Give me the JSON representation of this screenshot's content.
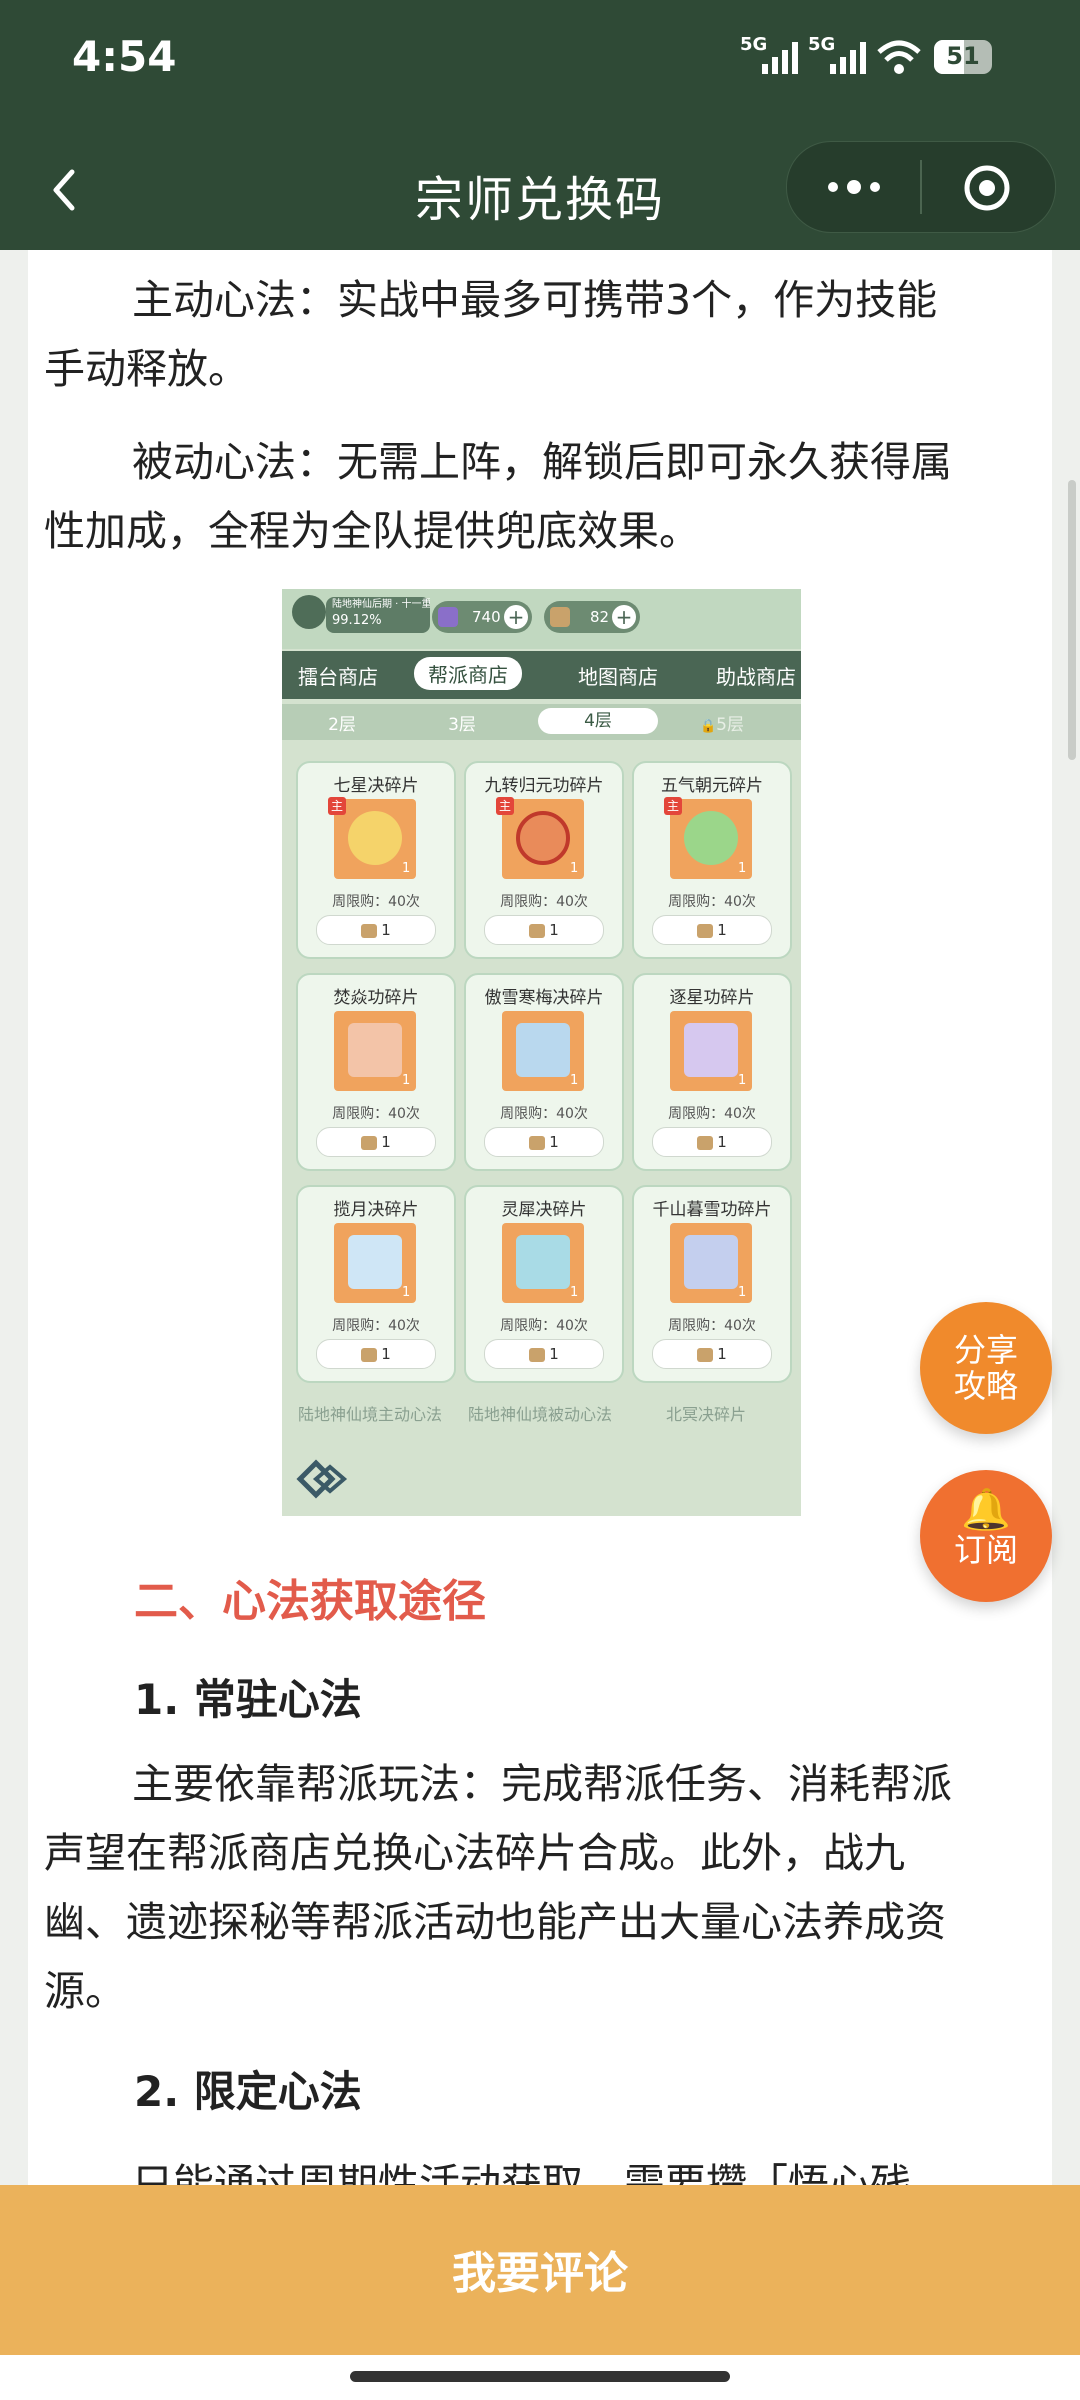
{
  "status_bar": {
    "time": "4:54",
    "net1": "5G",
    "net2": "5G",
    "battery": "51"
  },
  "nav": {
    "title": "宗师兑换码"
  },
  "article": {
    "p1_lines": [
      "主动心法：实战中最多可携带3个，作为技能",
      "手动释放。"
    ],
    "p2_lines": [
      "被动心法：无需上阵，解锁后即可永久获得属",
      "性加成，全程为全队提供兜底效果。"
    ],
    "section2_title": "二、心法获取途径",
    "sub1_title": "1. 常驻心法",
    "p3_lines": [
      "主要依靠帮派玩法：完成帮派任务、消耗帮派",
      "声望在帮派商店兑换心法碎片合成。此外，战九",
      "幽、遗迹探秘等帮派活动也能产出大量心法养成资",
      "源。"
    ],
    "sub2_title": "2. 限定心法",
    "p4_partial": "只能通过周期性活动获取，需要攒「悟心残"
  },
  "game": {
    "player": "陆地神仙后期 · 十一重",
    "progress": "99.12%",
    "currency1": "740",
    "currency2": "82",
    "tabs": [
      "擂台商店",
      "帮派商店",
      "地图商店",
      "助战商店"
    ],
    "floors": [
      "2层",
      "3层",
      "4层",
      "5层"
    ],
    "items": [
      {
        "name": "七星决碎片",
        "limit": "周限购：40次",
        "price": "1",
        "count": "1",
        "tag": "主"
      },
      {
        "name": "九转归元功碎片",
        "limit": "周限购：40次",
        "price": "1",
        "count": "1",
        "tag": "主"
      },
      {
        "name": "五气朝元碎片",
        "limit": "周限购：40次",
        "price": "1",
        "count": "1",
        "tag": "主"
      },
      {
        "name": "焚焱功碎片",
        "limit": "周限购：40次",
        "price": "1",
        "count": "1",
        "tag": ""
      },
      {
        "name": "傲雪寒梅决碎片",
        "limit": "周限购：40次",
        "price": "1",
        "count": "1",
        "tag": ""
      },
      {
        "name": "逐星功碎片",
        "limit": "周限购：40次",
        "price": "1",
        "count": "1",
        "tag": ""
      },
      {
        "name": "揽月决碎片",
        "limit": "周限购：40次",
        "price": "1",
        "count": "1",
        "tag": ""
      },
      {
        "name": "灵犀决碎片",
        "limit": "周限购：40次",
        "price": "1",
        "count": "1",
        "tag": ""
      },
      {
        "name": "千山暮雪功碎片",
        "limit": "周限购：40次",
        "price": "1",
        "count": "1",
        "tag": ""
      }
    ],
    "bottom_labels": [
      "陆地神仙境主动心法",
      "陆地神仙境被动心法",
      "北冥决碎片"
    ]
  },
  "fab": {
    "share_line1": "分享",
    "share_line2": "攻略",
    "subscribe": "订阅"
  },
  "bottom": {
    "comment": "我要评论"
  },
  "colors": {
    "header": "#2f4a36",
    "accent_red": "#e25b4b",
    "fab_orange": "#f08a2c",
    "bottom_bar": "#ebb25b"
  }
}
